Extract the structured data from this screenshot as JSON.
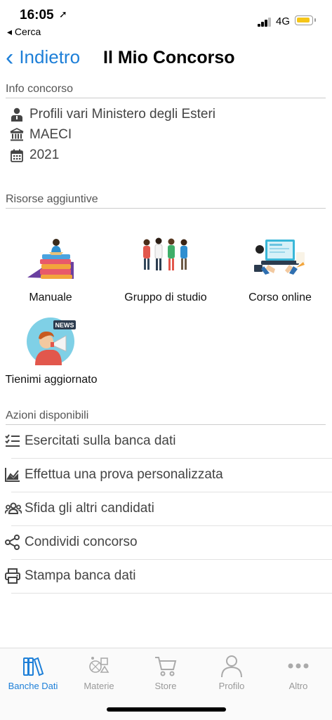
{
  "status": {
    "time": "16:05",
    "location_arrow": "➚",
    "back_app": "◂ Cerca",
    "network": "4G",
    "battery_color": "#f5c518"
  },
  "nav": {
    "back_label": "Indietro",
    "title": "Il Mio Concorso"
  },
  "info": {
    "header": "Info concorso",
    "rows": [
      {
        "icon": "person-icon",
        "text": "Profili vari Ministero degli Esteri"
      },
      {
        "icon": "institution-icon",
        "text": "MAECI"
      },
      {
        "icon": "calendar-icon",
        "text": "2021"
      }
    ]
  },
  "resources": {
    "header": "Risorse aggiuntive",
    "items": [
      {
        "label": "Manuale"
      },
      {
        "label": "Gruppo di studio"
      },
      {
        "label": "Corso online"
      },
      {
        "label": "Tienimi aggiornato",
        "badge": "NEWS"
      }
    ]
  },
  "actions": {
    "header": "Azioni disponibili",
    "items": [
      {
        "icon": "checklist-icon",
        "label": "Esercitati sulla banca dati"
      },
      {
        "icon": "chart-icon",
        "label": "Effettua una prova personalizzata"
      },
      {
        "icon": "group-icon",
        "label": "Sfida gli altri candidati"
      },
      {
        "icon": "share-icon",
        "label": "Condividi concorso"
      },
      {
        "icon": "print-icon",
        "label": "Stampa banca dati"
      }
    ]
  },
  "tabs": [
    {
      "label": "Banche Dati",
      "active": true
    },
    {
      "label": "Materie"
    },
    {
      "label": "Store"
    },
    {
      "label": "Profilo"
    },
    {
      "label": "Altro"
    }
  ],
  "accent_color": "#1d7fd8"
}
